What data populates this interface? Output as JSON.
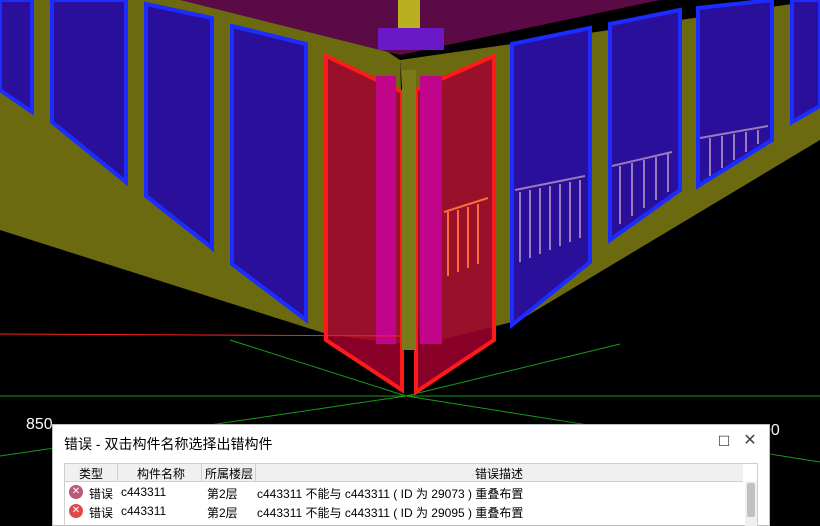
{
  "viewport": {
    "left_axis_value": "850",
    "right_axis_value": "00"
  },
  "dialog": {
    "title": "错误 - 双击构件名称选择出错构件",
    "maximize_icon": "maximize-icon",
    "close_icon": "close-icon",
    "columns": [
      "类型",
      "构件名称",
      "所属楼层",
      "错误描述"
    ],
    "rows": [
      {
        "type": "错误",
        "name": "c443311",
        "floor": "第2层",
        "description": "c443311 不能与 c443311 ( ID 为 29073 ) 重叠布置",
        "icon": "error-icon"
      },
      {
        "type": "错误",
        "name": "c443311",
        "floor": "第2层",
        "description": "c443311 不能与 c443311 ( ID 为 29095 ) 重叠布置",
        "icon": "error-icon"
      }
    ]
  },
  "colors": {
    "wall": "#6b6a10",
    "window_fill": "#2a0f9a",
    "window_frame": "#1a2cff",
    "error_highlight": "#ff1a1a",
    "error_fill": "#a0002e",
    "error_icon": "#e04a4a",
    "error_icon_selected": "#b85a78"
  }
}
